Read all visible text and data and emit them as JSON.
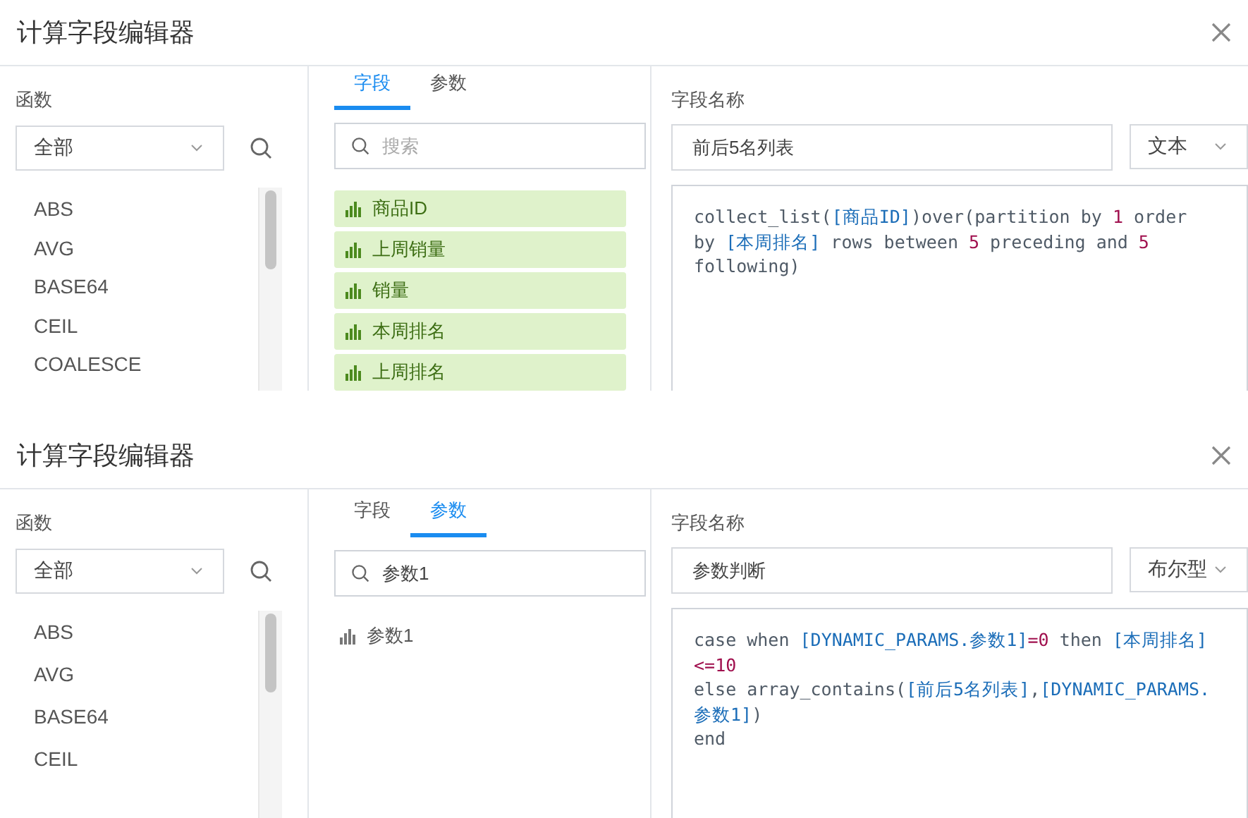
{
  "dialogs": [
    {
      "title": "计算字段编辑器",
      "functions": {
        "label": "函数",
        "category": "全部",
        "items": [
          "ABS",
          "AVG",
          "BASE64",
          "CEIL",
          "COALESCE"
        ]
      },
      "tabs": [
        {
          "label": "字段",
          "selected": true
        },
        {
          "label": "参数",
          "selected": false
        }
      ],
      "search": {
        "placeholder": "搜索"
      },
      "fields": [
        {
          "label": "商品ID",
          "kind": "field"
        },
        {
          "label": "上周销量",
          "kind": "field"
        },
        {
          "label": "销量",
          "kind": "field"
        },
        {
          "label": "本周排名",
          "kind": "field"
        },
        {
          "label": "上周排名",
          "kind": "field"
        }
      ],
      "name_label": "字段名称",
      "name_value": "前后5名列表",
      "type_value": "文本",
      "code": [
        [
          {
            "text": "collect_list(",
            "kind": "plain"
          },
          {
            "text": "[商品ID]",
            "kind": "field"
          },
          {
            "text": ")over(partition by ",
            "kind": "plain"
          },
          {
            "text": "1",
            "kind": "number"
          },
          {
            "text": " order",
            "kind": "plain"
          }
        ],
        [
          {
            "text": "by ",
            "kind": "plain"
          },
          {
            "text": "[本周排名]",
            "kind": "field"
          },
          {
            "text": " rows between ",
            "kind": "plain"
          },
          {
            "text": "5",
            "kind": "number"
          },
          {
            "text": " preceding and ",
            "kind": "plain"
          },
          {
            "text": "5",
            "kind": "number"
          }
        ],
        [
          {
            "text": "following)",
            "kind": "plain"
          }
        ]
      ]
    },
    {
      "title": "计算字段编辑器",
      "functions": {
        "label": "函数",
        "category": "全部",
        "items": [
          "ABS",
          "AVG",
          "BASE64",
          "CEIL"
        ]
      },
      "tabs": [
        {
          "label": "字段",
          "selected": false
        },
        {
          "label": "参数",
          "selected": true
        }
      ],
      "search": {
        "value": "参数1"
      },
      "fields": [
        {
          "label": "参数1",
          "kind": "param"
        }
      ],
      "name_label": "字段名称",
      "name_value": "参数判断",
      "type_value": "布尔型",
      "code": [
        [
          {
            "text": "case when ",
            "kind": "plain"
          },
          {
            "text": "[DYNAMIC_PARAMS.参数1]",
            "kind": "field"
          },
          {
            "text": "=",
            "kind": "operator"
          },
          {
            "text": "0",
            "kind": "number"
          },
          {
            "text": " then ",
            "kind": "plain"
          },
          {
            "text": "[本周排名]",
            "kind": "field"
          }
        ],
        [
          {
            "text": "<=",
            "kind": "operator"
          },
          {
            "text": "10",
            "kind": "number"
          }
        ],
        [
          {
            "text": "else array_contains(",
            "kind": "plain"
          },
          {
            "text": "[前后5名列表]",
            "kind": "field"
          },
          {
            "text": ",",
            "kind": "plain"
          },
          {
            "text": "[DYNAMIC_PARAMS.",
            "kind": "field"
          }
        ],
        [
          {
            "text": "参数1]",
            "kind": "field"
          },
          {
            "text": ")",
            "kind": "plain"
          }
        ],
        [
          {
            "text": "end",
            "kind": "plain"
          }
        ]
      ]
    }
  ]
}
